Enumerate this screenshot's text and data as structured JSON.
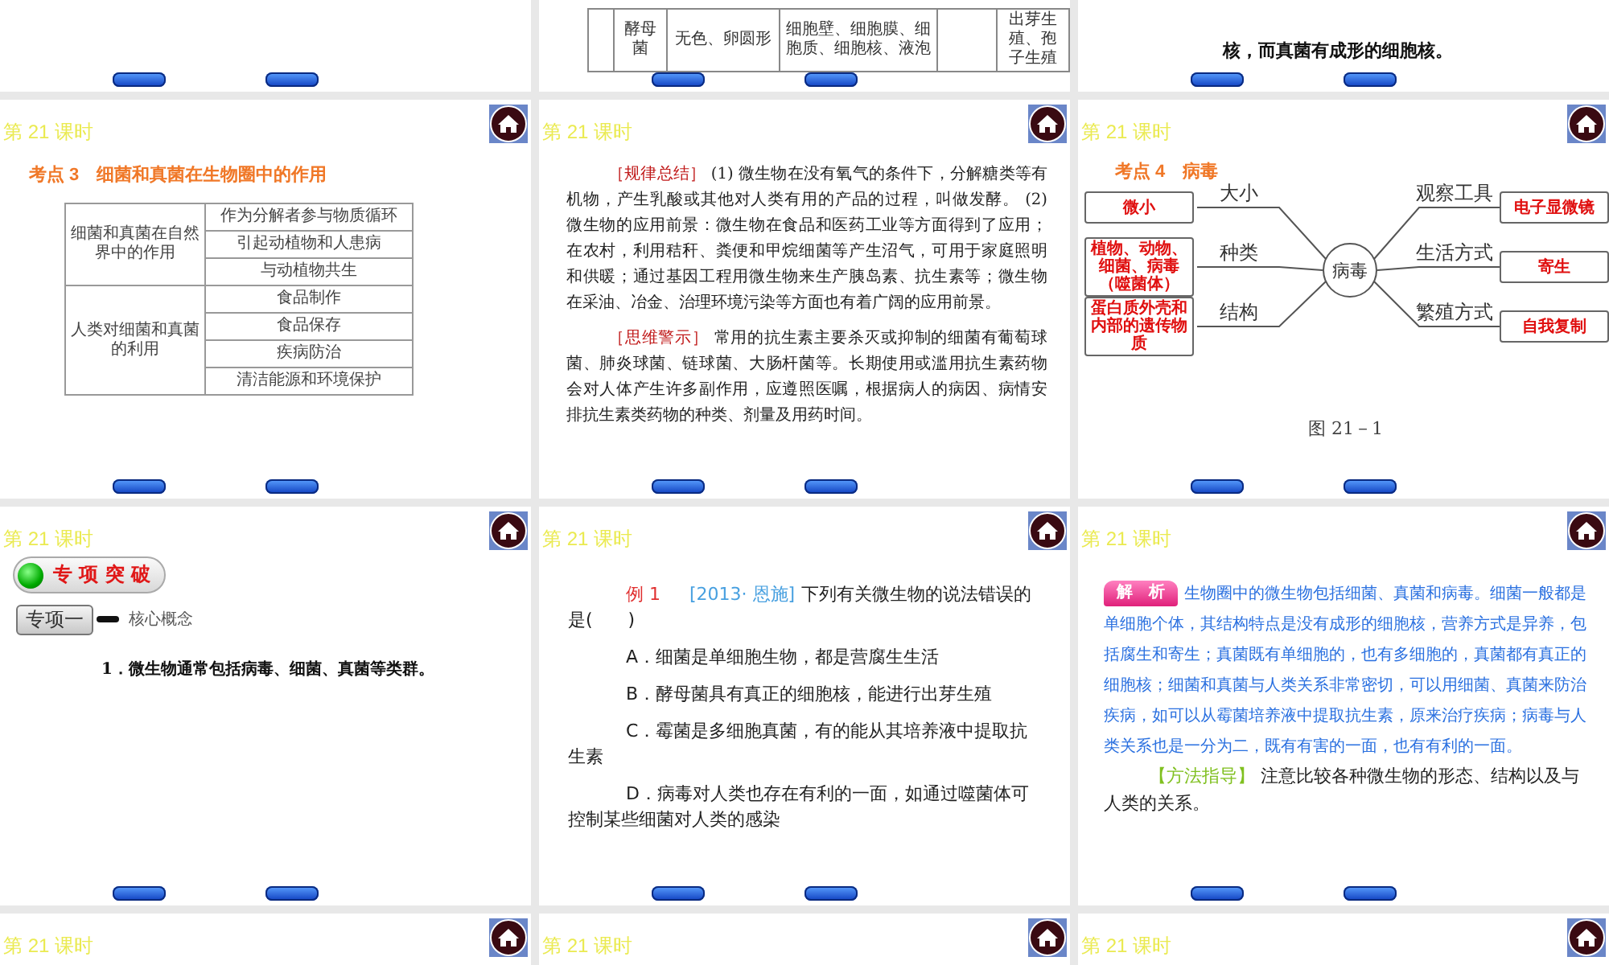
{
  "slides": [
    {
      "kind": "blank"
    },
    {
      "kind": "table_tail",
      "cells": [
        {},
        {
          "text": "酵母菌"
        },
        {
          "text": "无色、卵圆形"
        },
        {
          "text": "细胞壁、细胞膜、细胞质、细胞核、液泡"
        },
        {},
        {
          "text": "出芽生殖、孢子生殖"
        }
      ]
    },
    {
      "kind": "text_tail",
      "text": "核，而真菌有成形的细胞核。"
    },
    {
      "kind": "table",
      "header": "第 21 课时",
      "title": "考点 3　细菌和真菌在生物圈中的作用",
      "groups": [
        {
          "label": "细菌和真菌在自然界中的作用",
          "items": [
            "作为分解者参与物质循环",
            "引起动植物和人患病",
            "与动植物共生"
          ]
        },
        {
          "label": "人类对细菌和真菌的利用",
          "items": [
            "食品制作",
            "食品保存",
            "疾病防治",
            "清洁能源和环境保护"
          ]
        }
      ]
    },
    {
      "kind": "notes",
      "header": "第 21 课时",
      "paragraphs": [
        {
          "tag": "［规律总结］",
          "text": "(1) 微生物在没有氧气的条件下，分解糖类等有机物，产生乳酸或其他对人类有用的产品的过程，叫做发酵。 (2) 微生物的应用前景：微生物在食品和医药工业等方面得到了应用；在农村，利用秸秆、粪便和甲烷细菌等产生沼气，可用于家庭照明和供暖；通过基因工程用微生物来生产胰岛素、抗生素等；微生物在采油、冶金、治理环境污染等方面也有着广阔的应用前景。"
        },
        {
          "tag": "［思维警示］",
          "text": "常用的抗生素主要杀灭或抑制的细菌有葡萄球菌、肺炎球菌、链球菌、大肠杆菌等。长期使用或滥用抗生素药物会对人体产生许多副作用，应遵照医嘱，根据病人的病因、病情安排抗生素类药物的种类、剂量及用药时间。"
        }
      ]
    },
    {
      "kind": "mindmap",
      "header": "第 21 课时",
      "title": "考点 4　病毒",
      "center": "病毒",
      "left": [
        {
          "label": "大小",
          "value": "微小"
        },
        {
          "label": "种类",
          "value": "植物、动物、细菌、病毒（噬菌体）"
        },
        {
          "label": "结构",
          "value": "蛋白质外壳和内部的遗传物质"
        }
      ],
      "right": [
        {
          "label": "观察工具",
          "value": "电子显微镜"
        },
        {
          "label": "生活方式",
          "value": "寄生"
        },
        {
          "label": "繁殖方式",
          "value": "自我复制"
        }
      ],
      "caption": "图 21－1"
    },
    {
      "kind": "section",
      "header": "第 21 课时",
      "badge": "专 项 突 破",
      "tag": "专项一",
      "tag_text": "核心概念",
      "item": "1．微生物通常包括病毒、细菌、真菌等类群。"
    },
    {
      "kind": "question",
      "header": "第 21 课时",
      "label": "例 1",
      "source": "[2013· 恩施]",
      "stem": "下列有关微生物的说法错误的是(　　)",
      "options": [
        "A．细菌是单细胞生物，都是营腐生生活",
        "B．酵母菌具有真正的细胞核，能进行出芽生殖",
        "C．霉菌是多细胞真菌，有的能从其培养液中提取抗生素",
        "D．病毒对人类也存在有利的一面，如通过噬菌体可控制某些细菌对人类的感染"
      ]
    },
    {
      "kind": "analysis",
      "header": "第 21 课时",
      "badge": "解　析",
      "text": "生物圈中的微生物包括细菌、真菌和病毒。细菌一般都是单细胞个体，其结构特点是没有成形的细胞核，营养方式是异养，包括腐生和寄生；真菌既有单细胞的，也有多细胞的，真菌都有真正的细胞核；细菌和真菌与人类关系非常密切，可以用细菌、真菌来防治疾病，如可以从霉菌培养液中提取抗生素，原来治疗疾病；病毒与人类关系也是一分为二，既有有害的一面，也有有利的一面。",
      "guide_tag": "【方法指导】",
      "guide": "注意比较各种微生物的形态、结构以及与人类的关系。"
    },
    {
      "kind": "header_only",
      "header": "第 21 课时"
    },
    {
      "kind": "header_only",
      "header": "第 21 课时"
    },
    {
      "kind": "header_only",
      "header": "第 21 课时"
    }
  ]
}
